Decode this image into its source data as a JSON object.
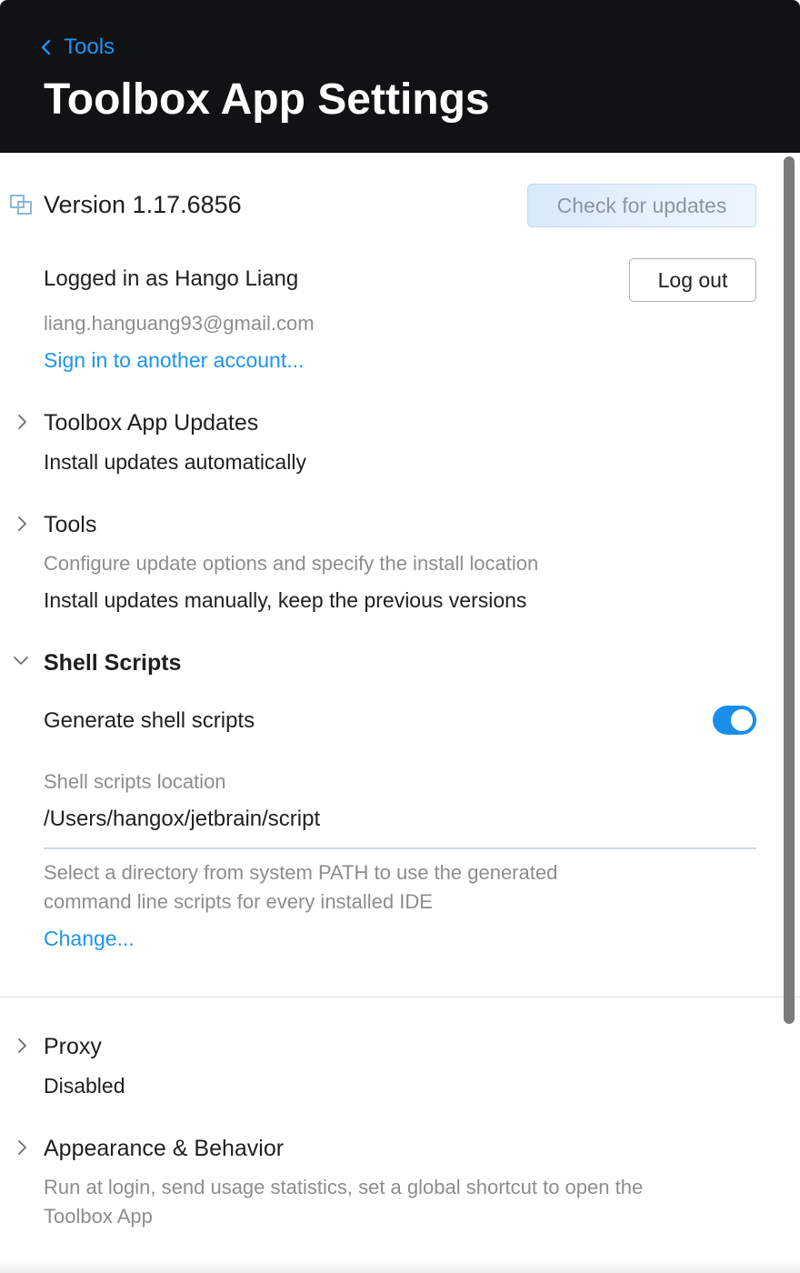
{
  "header": {
    "back_label": "Tools",
    "title": "Toolbox App Settings"
  },
  "version": {
    "text": "Version 1.17.6856",
    "check_button": "Check for updates"
  },
  "account": {
    "logged_in": "Logged in as Hango Liang",
    "email": "liang.hanguang93@gmail.com",
    "sign_in_link": "Sign in to another account...",
    "logout_button": "Log out"
  },
  "sections": {
    "updates": {
      "title": "Toolbox App Updates",
      "value": "Install updates automatically"
    },
    "tools": {
      "title": "Tools",
      "description": "Configure update options and specify the install location",
      "value": "Install updates manually, keep the previous versions"
    },
    "shell": {
      "title": "Shell Scripts",
      "generate_label": "Generate shell scripts",
      "generate_enabled": true,
      "location_label": "Shell scripts location",
      "location_value": "/Users/hangox/jetbrain/script",
      "help_line1": "Select a directory from system PATH to use the generated",
      "help_line2": "command line scripts for every installed IDE",
      "change_link": "Change..."
    },
    "proxy": {
      "title": "Proxy",
      "value": "Disabled"
    },
    "appearance": {
      "title": "Appearance & Behavior",
      "description_line1": "Run at login, send usage statistics, set a global shortcut to open the",
      "description_line2": "Toolbox App"
    }
  },
  "colors": {
    "header_bg": "#111214",
    "accent": "#1c94f2",
    "toggle_on": "#1a8fea",
    "muted_text": "#8d8d8d"
  },
  "icons": {
    "back": "chevron-left-icon",
    "version": "toolbox-logo-icon",
    "collapsed": "chevron-right-icon",
    "expanded": "chevron-down-icon"
  }
}
